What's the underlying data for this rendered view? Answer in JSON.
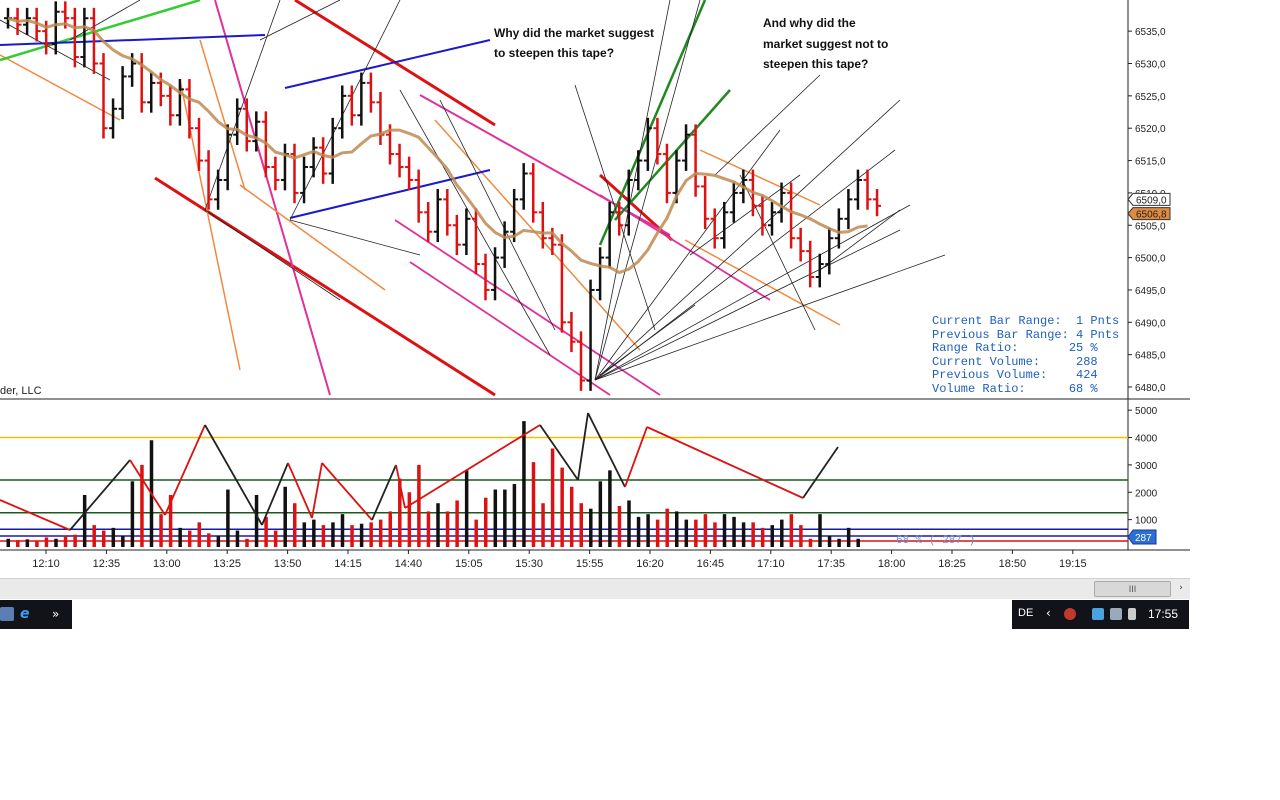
{
  "chart_data": [
    {
      "type": "bar",
      "subtype": "ohlc",
      "pane": "price",
      "y_ticks": [
        6480.0,
        6485.0,
        6490.0,
        6495.0,
        6500.0,
        6505.0,
        6510.0,
        6515.0,
        6520.0,
        6525.0,
        6530.0,
        6535.0
      ],
      "y_tick_labels": [
        "6480,0",
        "6485,0",
        "6490,0",
        "6495,0",
        "6500,0",
        "6505,0",
        "6510,0",
        "6515,0",
        "6520,0",
        "6525,0",
        "6530,0",
        "6535,0"
      ],
      "ylim": [
        6478.0,
        6539.0
      ],
      "price_markers": [
        {
          "label": "6509,0",
          "value": 6509.0,
          "color": "#ffffff"
        },
        {
          "label": "6506,8",
          "value": 6506.8,
          "color": "#e08a40"
        }
      ],
      "colors": {
        "up": "#111111",
        "down": "#dd1111",
        "moving_average": "#c08850"
      }
    },
    {
      "type": "bar",
      "pane": "volume",
      "y_ticks": [
        1000,
        2000,
        3000,
        4000,
        5000
      ],
      "y_tick_labels": [
        "1000",
        "2000",
        "3000",
        "4000",
        "5000"
      ],
      "ylim": [
        0,
        5300
      ],
      "reference_lines": [
        {
          "value": 4000,
          "color": "#f2c200"
        },
        {
          "value": 2450,
          "color": "#1a5a1a"
        },
        {
          "value": 1250,
          "color": "#1a5a1a"
        },
        {
          "value": 650,
          "color": "#1a1aaa"
        }
      ],
      "current_marker": {
        "label": "287",
        "value": 287
      },
      "footer_text": "68 % ( 287 )",
      "colors": {
        "up": "#111111",
        "down": "#dd1111"
      }
    }
  ],
  "time_axis": {
    "labels": [
      "12:10",
      "12:35",
      "13:00",
      "13:25",
      "13:50",
      "14:15",
      "14:40",
      "15:05",
      "15:30",
      "15:55",
      "16:20",
      "16:45",
      "17:10",
      "17:35",
      "18:00",
      "18:25",
      "18:50",
      "19:15"
    ]
  },
  "annotations": {
    "left_question": [
      "Why did the market suggest",
      "to steepen this tape?"
    ],
    "right_question": [
      "And why did the",
      "market suggest not to",
      "steepen this tape?"
    ]
  },
  "stats_box": {
    "lines": [
      "Current Bar Range:  1 Pnts",
      "Previous Bar Range: 4 Pnts",
      "Range Ratio:       25 %",
      "Current Volume:     288",
      "Previous Volume:    424",
      "Volume Ratio:      68 %"
    ]
  },
  "vendor_label": "der, LLC",
  "scrollbar": {
    "thumb_glyph": "III",
    "arrow_glyph": "›"
  },
  "taskbar": {
    "overflow_glyph": "»",
    "ie_glyph": "e",
    "language": "DE",
    "chevron_glyph": "‹",
    "clock": "17:55"
  }
}
